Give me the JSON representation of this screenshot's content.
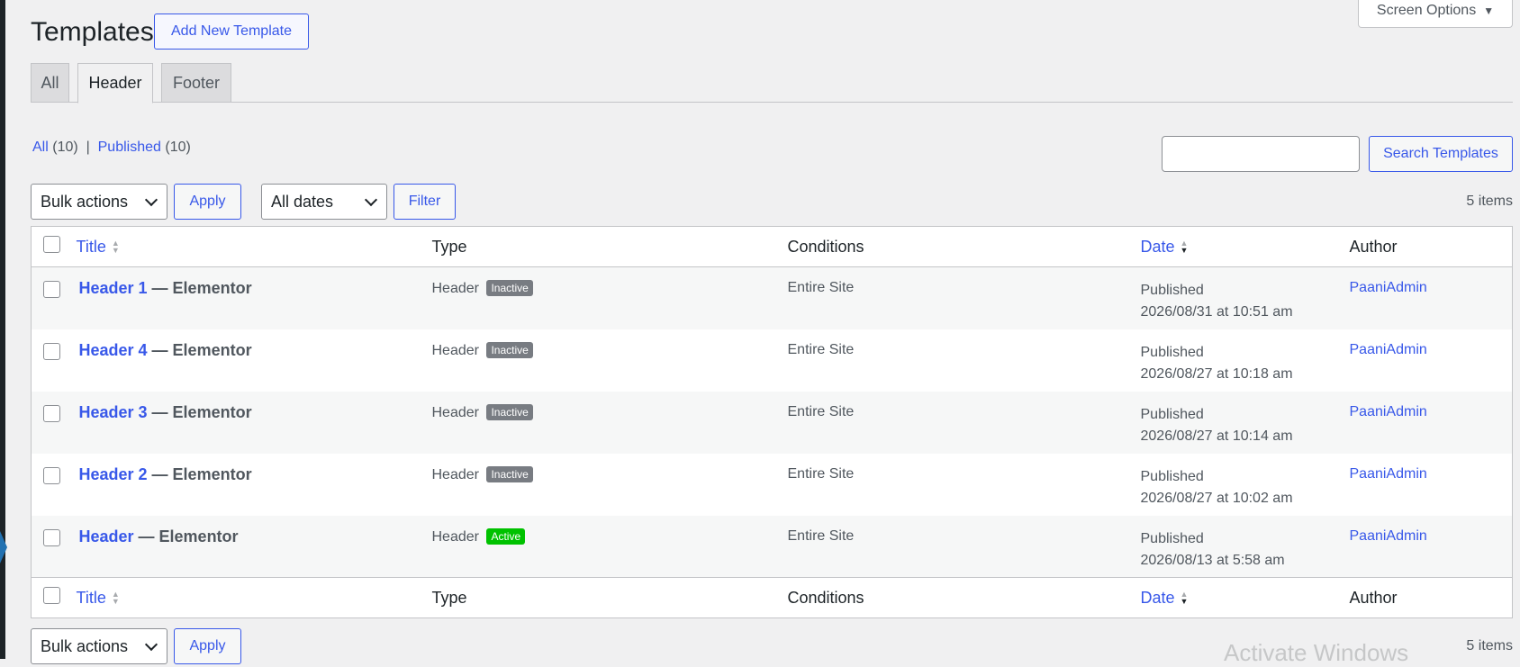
{
  "page": {
    "title": "Templates",
    "add_new_label": "Add New Template",
    "screen_options_label": "Screen Options"
  },
  "tabs": [
    {
      "label": "All",
      "active": false
    },
    {
      "label": "Header",
      "active": true
    },
    {
      "label": "Footer",
      "active": false
    }
  ],
  "views": {
    "all_label": "All",
    "all_count": "(10)",
    "separator": "|",
    "published_label": "Published",
    "published_count": "(10)"
  },
  "search": {
    "value": "",
    "button_label": "Search Templates"
  },
  "top_actions": {
    "bulk_selected": "Bulk actions",
    "apply_label": "Apply",
    "dates_selected": "All dates",
    "filter_label": "Filter",
    "items_count": "5 items"
  },
  "table": {
    "columns": {
      "title": "Title",
      "type": "Type",
      "conditions": "Conditions",
      "date": "Date",
      "author": "Author"
    },
    "rows": [
      {
        "name": "Header 1",
        "suffix": " — Elementor",
        "type": "Header",
        "status": "Inactive",
        "status_color": "#787c82",
        "conditions": "Entire Site",
        "date_status": "Published",
        "date": "2026/08/31 at 10:51 am",
        "author": "PaaniAdmin"
      },
      {
        "name": "Header 4",
        "suffix": " — Elementor",
        "type": "Header",
        "status": "Inactive",
        "status_color": "#787c82",
        "conditions": "Entire Site",
        "date_status": "Published",
        "date": "2026/08/27 at 10:18 am",
        "author": "PaaniAdmin"
      },
      {
        "name": "Header 3",
        "suffix": " — Elementor",
        "type": "Header",
        "status": "Inactive",
        "status_color": "#787c82",
        "conditions": "Entire Site",
        "date_status": "Published",
        "date": "2026/08/27 at 10:14 am",
        "author": "PaaniAdmin"
      },
      {
        "name": "Header 2",
        "suffix": " — Elementor",
        "type": "Header",
        "status": "Inactive",
        "status_color": "#787c82",
        "conditions": "Entire Site",
        "date_status": "Published",
        "date": "2026/08/27 at 10:02 am",
        "author": "PaaniAdmin"
      },
      {
        "name": "Header",
        "suffix": " — Elementor",
        "type": "Header",
        "status": "Active",
        "status_color": "#00c200",
        "conditions": "Entire Site",
        "date_status": "Published",
        "date": "2026/08/13 at 5:58 am",
        "author": "PaaniAdmin"
      }
    ]
  },
  "bottom_actions": {
    "bulk_selected": "Bulk actions",
    "apply_label": "Apply",
    "items_count": "5 items"
  },
  "watermark": "Activate Windows",
  "colors": {
    "accent": "#3858e9",
    "background": "#f0f0f1",
    "active_badge": "#00c200",
    "inactive_badge": "#787c82"
  }
}
